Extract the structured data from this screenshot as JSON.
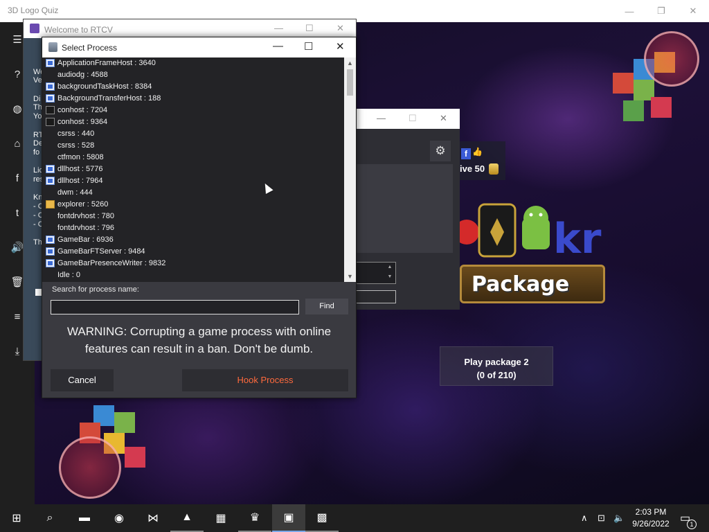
{
  "game_window": {
    "title": "3D Logo Quiz",
    "minimize": "—",
    "maximize": "❐",
    "close": "✕"
  },
  "side_nav": {
    "icons": [
      "hamburger-icon",
      "help-icon",
      "globe-icon",
      "home-icon",
      "facebook-icon",
      "twitter-icon",
      "sound-icon",
      "trash-icon",
      "list-icon",
      "download-icon"
    ],
    "glyphs": [
      "☰",
      "?",
      "◍",
      "⌂",
      "f",
      "t",
      "🔊",
      "🗑",
      "≡",
      "⤓"
    ]
  },
  "rtcv_window": {
    "title": "Welcome to RTCV",
    "minimize": "—",
    "maximize": "☐",
    "close": "✕",
    "peek_lines": [
      "We",
      "Ve",
      "Di",
      "Th",
      "Yo",
      "RT",
      "De",
      "fo",
      "Lic",
      "res",
      "Kn",
      "- C",
      "- C",
      "- C",
      "Th"
    ]
  },
  "settings_window": {
    "minimize": "—",
    "maximize": "☐",
    "close": "✕",
    "gear": "⚙"
  },
  "share_box": {
    "fb": "f",
    "thumb": "👍",
    "give_text": "ive 50"
  },
  "banner": {
    "text": "Package"
  },
  "play_button": {
    "line1": "Play package 2",
    "line2": "(0 of 210)"
  },
  "dialog": {
    "title": "Select Process",
    "minimize": "—",
    "maximize": "☐",
    "close": "✕",
    "processes": [
      {
        "name": "ApplicationFrameHost : 3640",
        "icon": "blue"
      },
      {
        "name": "audiodg : 4588",
        "icon": "none"
      },
      {
        "name": "backgroundTaskHost : 8384",
        "icon": "blue"
      },
      {
        "name": "BackgroundTransferHost : 188",
        "icon": "blue"
      },
      {
        "name": "conhost : 7204",
        "icon": "console"
      },
      {
        "name": "conhost : 9364",
        "icon": "console"
      },
      {
        "name": "csrss : 440",
        "icon": "none"
      },
      {
        "name": "csrss : 528",
        "icon": "none"
      },
      {
        "name": "ctfmon : 5808",
        "icon": "none"
      },
      {
        "name": "dllhost : 5776",
        "icon": "blue"
      },
      {
        "name": "dllhost : 7964",
        "icon": "blue"
      },
      {
        "name": "dwm : 444",
        "icon": "none"
      },
      {
        "name": "explorer : 5260",
        "icon": "folder"
      },
      {
        "name": "fontdrvhost : 780",
        "icon": "none"
      },
      {
        "name": "fontdrvhost : 796",
        "icon": "none"
      },
      {
        "name": "GameBar : 6936",
        "icon": "blue"
      },
      {
        "name": "GameBarFTServer : 9484",
        "icon": "blue"
      },
      {
        "name": "GameBarPresenceWriter : 9832",
        "icon": "blue"
      },
      {
        "name": "Idle : 0",
        "icon": "none"
      }
    ],
    "scroll_up": "▲",
    "scroll_down": "▼",
    "search_label": "Search for process name:",
    "search_value": "",
    "find_label": "Find",
    "warning": "WARNING: Corrupting a game process with online features can result in a ban.  Don't be dumb.",
    "cancel_label": "Cancel",
    "hook_label": "Hook Process",
    "hook_color": "#ff6a3d"
  },
  "taskbar": {
    "apps": [
      {
        "name": "start-icon",
        "glyph": "⊞",
        "state": ""
      },
      {
        "name": "search-icon",
        "glyph": "⌕",
        "state": ""
      },
      {
        "name": "file-explorer-icon",
        "glyph": "▬",
        "state": ""
      },
      {
        "name": "chrome-icon",
        "glyph": "◉",
        "state": ""
      },
      {
        "name": "visual-studio-icon",
        "glyph": "⋈",
        "state": ""
      },
      {
        "name": "app-triangle-icon",
        "glyph": "▲",
        "state": "open"
      },
      {
        "name": "store-icon",
        "glyph": "▦",
        "state": ""
      },
      {
        "name": "game-icon",
        "glyph": "♛",
        "state": "open"
      },
      {
        "name": "process-app-icon",
        "glyph": "▣",
        "state": "active"
      },
      {
        "name": "logo-quiz-icon",
        "glyph": "▩",
        "state": "open"
      }
    ],
    "tray_chevron": "∧",
    "tray_network": "⊡",
    "tray_volume": "🔈",
    "time": "2:03 PM",
    "date": "9/26/2022",
    "notification": "▭",
    "notification_count": "1"
  }
}
